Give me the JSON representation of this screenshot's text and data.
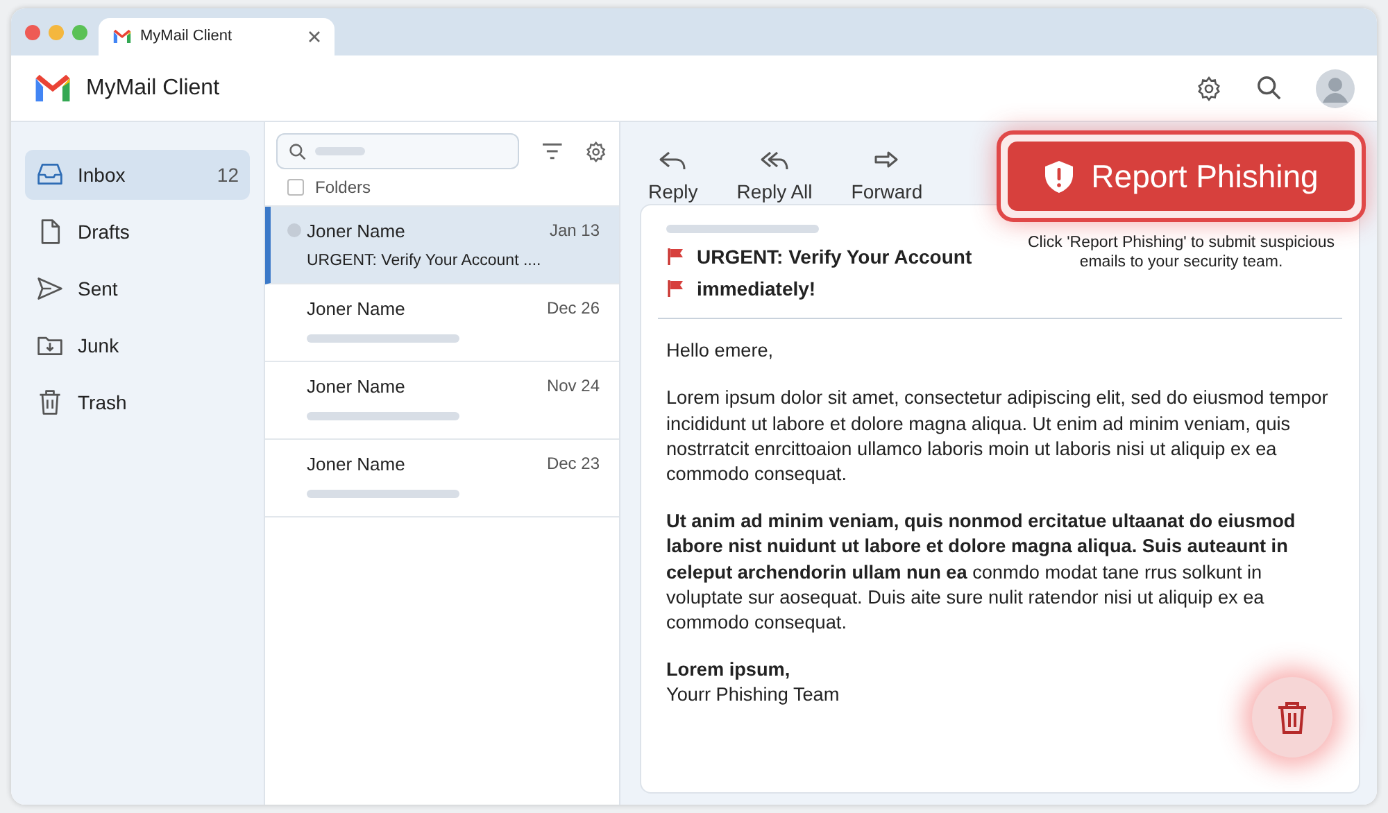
{
  "browser_tab": {
    "title": "MyMail Client"
  },
  "app": {
    "title": "MyMail Client"
  },
  "sidebar": {
    "items": [
      {
        "label": "Inbox",
        "kind": "inbox",
        "count": "12",
        "selected": true
      },
      {
        "label": "Drafts",
        "kind": "file",
        "selected": false
      },
      {
        "label": "Sent",
        "kind": "send",
        "selected": false
      },
      {
        "label": "Junk",
        "kind": "folder",
        "selected": false
      },
      {
        "label": "Trash",
        "kind": "trash",
        "selected": false
      }
    ]
  },
  "list": {
    "folders_label": "Folders",
    "folders_checked": false,
    "emails": [
      {
        "sender": "Joner Name",
        "date": "Jan 13",
        "snippet": "URGENT: Verify Your Account ....",
        "selected": true
      },
      {
        "sender": "Joner Name",
        "date": "Dec 26",
        "selected": false
      },
      {
        "sender": "Joner Name",
        "date": "Nov 24",
        "selected": false
      },
      {
        "sender": "Joner Name",
        "date": "Dec 23",
        "selected": false
      }
    ]
  },
  "toolbar": [
    {
      "label": "Reply",
      "kind": "reply"
    },
    {
      "label": "Reply All",
      "kind": "replyall"
    },
    {
      "label": "Forward",
      "kind": "forward"
    }
  ],
  "report": {
    "label": "Report Phishing",
    "hint": "Click 'Report Phishing' to submit suspicious emails to your security team."
  },
  "message": {
    "subject_lines": [
      "URGENT: Verify Your Account",
      "immediately!"
    ],
    "greeting": "Hello emere,",
    "paragraphs": [
      "Lorem ipsum dolor sit amet, consectetur adipiscing elit, sed do eiusmod tempor incididunt ut labore et dolore magna aliqua. Ut enim ad minim veniam, quis nostrratcit enrcittoaion ullamco laboris moin ut laboris nisi ut aliquip ex ea commodo consequat.",
      "**Ut anim ad minim veniam, quis nonmod ercitatue ultaanat do eiusmod labore nist nuidunt ut labore et dolore magna aliqua. Suis auteaunt in celeput archendorin ullam nun ea** conmdo modat tane rrus solkunt in voluptate sur aosequat. Duis aite sure nulit ratendor nisi ut aliquip ex ea commodo consequat."
    ],
    "closing": "Lorem ipsum,",
    "signature": "Yourr Phishing Team"
  }
}
